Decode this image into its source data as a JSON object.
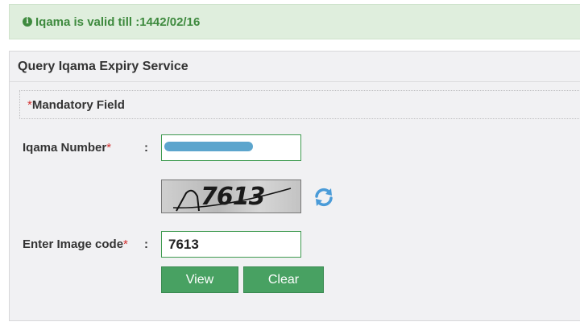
{
  "alert": {
    "message": "Iqama is valid till :1442/02/16",
    "icon": "info-circle-icon"
  },
  "panel": {
    "title": "Query Iqama Expiry Service",
    "mandatory_note": "Mandatory Field",
    "required_marker": "*"
  },
  "form": {
    "iqama_number_label": "Iqama Number",
    "iqama_number_value": "",
    "captcha_text": "7613",
    "image_code_label": "Enter Image code",
    "image_code_value": "7613",
    "colon": ":"
  },
  "buttons": {
    "view_label": "View",
    "clear_label": "Clear"
  },
  "colors": {
    "accent": "#48a162",
    "alert_bg": "#dfeedd",
    "alert_text": "#3e8a3e",
    "required": "#d32f2f",
    "refresh_icon": "#4a9bd8"
  }
}
